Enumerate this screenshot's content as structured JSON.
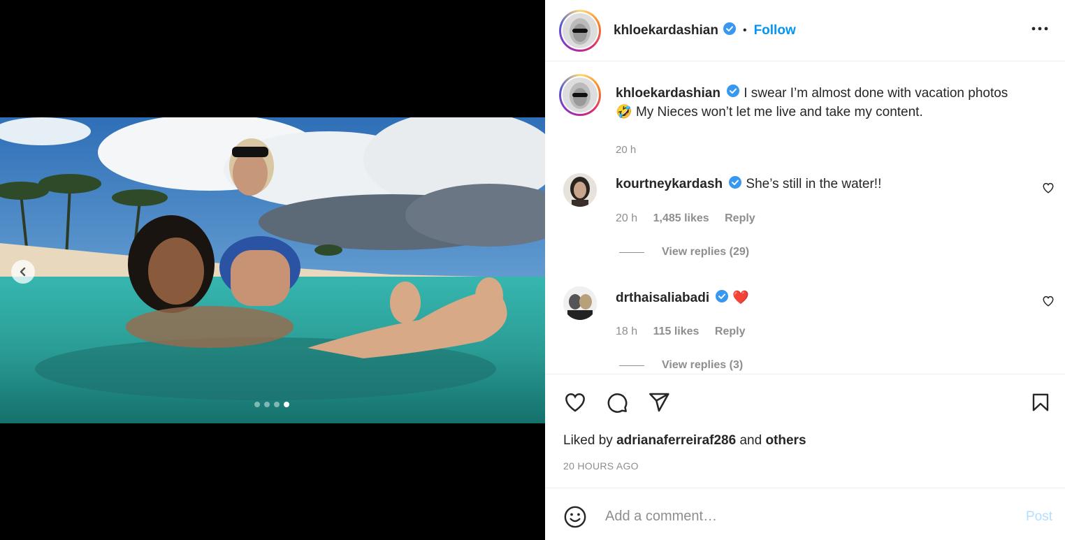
{
  "media": {
    "carousel_count": 4,
    "carousel_active_index": 4,
    "icons": {
      "prev": "chevron-left-icon"
    }
  },
  "header": {
    "username": "khloekardashian",
    "separator": "•",
    "follow_label": "Follow",
    "icons": {
      "verified": "verified-badge-icon",
      "more": "more-options-icon"
    }
  },
  "caption": {
    "username": "khloekardashian",
    "text_line1": "I swear I’m almost done with vacation photos",
    "emoji": "🤣",
    "text_line2": "My Nieces won’t let me live and take my content.",
    "time": "20 h"
  },
  "comments": [
    {
      "username": "kourtneykardash",
      "text": "She’s still in the water!!",
      "time": "20 h",
      "likes": "1,485 likes",
      "reply_label": "Reply",
      "view_replies": "View replies (29)"
    },
    {
      "username": "drthaisaliabadi",
      "text": "❤️",
      "time": "18 h",
      "likes": "115 likes",
      "reply_label": "Reply",
      "view_replies": "View replies (3)"
    }
  ],
  "footer": {
    "liked_prefix": "Liked by",
    "liked_user": "adrianaferreiraf286",
    "liked_and": "and",
    "liked_others": "others",
    "timestamp": "20 HOURS AGO",
    "comment_placeholder": "Add a comment…",
    "post_label": "Post",
    "icons": {
      "like": "heart-icon",
      "comment": "comment-icon",
      "share": "share-icon",
      "save": "bookmark-icon",
      "emoji": "emoji-icon"
    }
  },
  "colors": {
    "accent": "#0095f6",
    "post_disabled": "#b2dffc",
    "secondary_text": "#8e8e8e",
    "primary_text": "#262626",
    "heart_red": "#ed4956"
  }
}
